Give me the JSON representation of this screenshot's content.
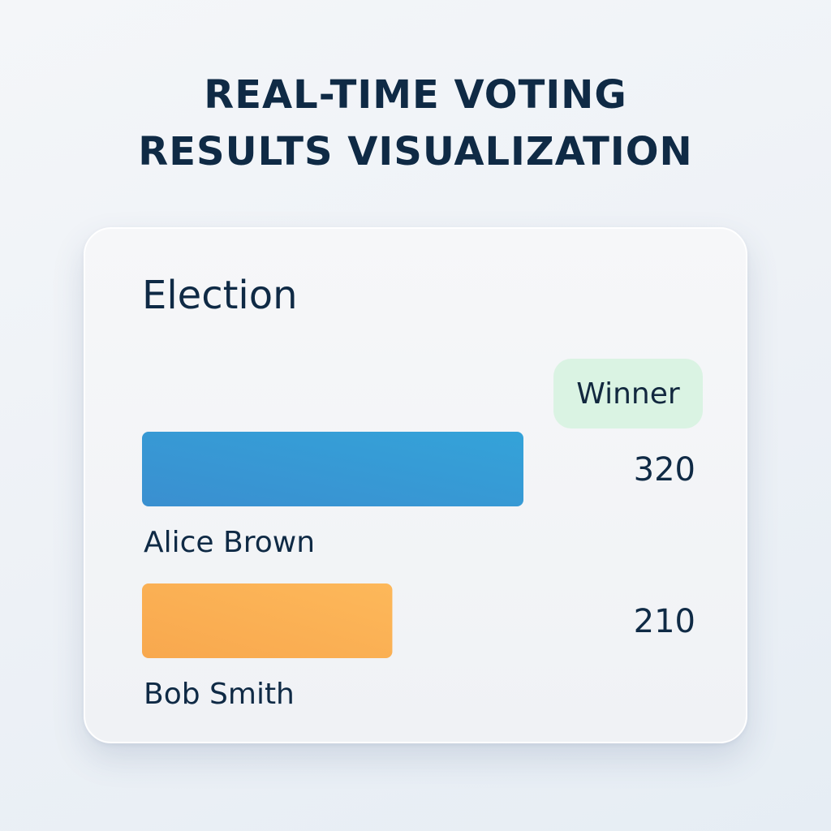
{
  "header": {
    "title_line1": "REAL-TIME VOTING",
    "title_line2": "RESULTS VISUALIZATION"
  },
  "card": {
    "title": "Election",
    "badge": "Winner"
  },
  "colors": {
    "series": [
      "#3a8fd0",
      "#f8a84e"
    ],
    "series_light": [
      "#34a3d9",
      "#fdb85a"
    ]
  },
  "chart_data": {
    "type": "bar",
    "orientation": "horizontal",
    "categories": [
      "Alice Brown",
      "Bob Smith"
    ],
    "values": [
      320,
      210
    ],
    "title": "Election",
    "xlabel": "",
    "ylabel": "",
    "xlim": [
      0,
      320
    ],
    "grid": false,
    "legend": "none"
  }
}
